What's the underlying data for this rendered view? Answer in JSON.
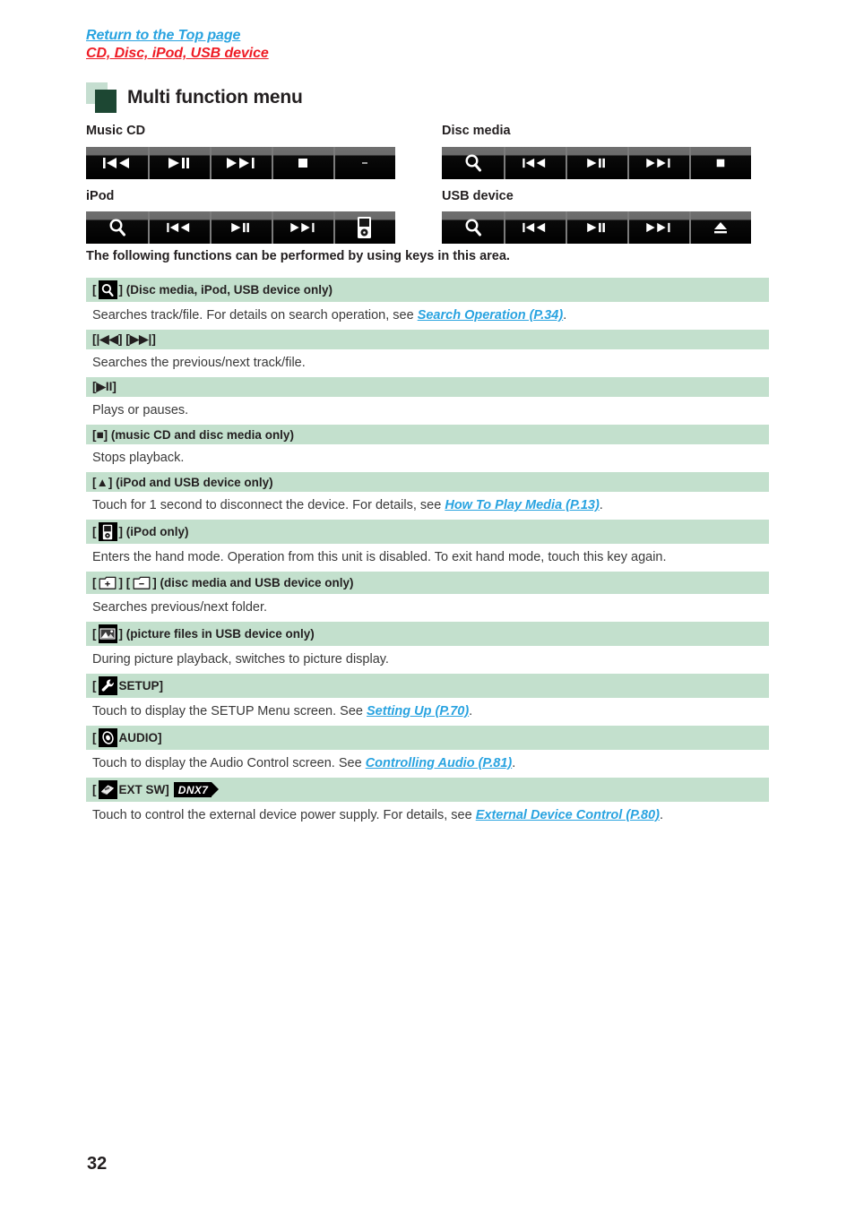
{
  "top_links": {
    "return_top": "Return to the Top page",
    "breadcrumb": "CD, Disc, iPod, USB device"
  },
  "heading": {
    "title": "Multi function menu",
    "mark_light_color": "#c5ded0",
    "mark_dark_color": "#1d4733"
  },
  "media_panels": [
    {
      "label": "Music CD",
      "keys": [
        "prev-track-icon",
        "play-pause-icon",
        "next-track-icon",
        "stop-icon",
        "blank-key"
      ]
    },
    {
      "label": "Disc media",
      "keys": [
        "search-icon",
        "prev-track-icon",
        "play-pause-icon",
        "next-track-icon",
        "stop-icon"
      ]
    },
    {
      "label": "iPod",
      "keys": [
        "search-icon",
        "prev-track-icon",
        "play-pause-icon",
        "next-track-icon",
        "ipod-hand-mode-icon"
      ]
    },
    {
      "label": "USB device",
      "keys": [
        "search-icon",
        "prev-track-icon",
        "play-pause-icon",
        "next-track-icon",
        "eject-icon"
      ]
    }
  ],
  "intro": "The following functions can be performed by using keys in this area.",
  "rows": [
    {
      "head_prefix": "[",
      "head_icon": "search-icon",
      "head_suffix": "] (Disc media, iPod, USB device only)",
      "body_before": "Searches track/file. For details on search operation, see ",
      "body_link": "Search Operation (P.34)",
      "body_after": "."
    },
    {
      "head_text": "[|◀◀] [▶▶|]",
      "body_before": "Searches the previous/next track/file.",
      "body_link": "",
      "body_after": ""
    },
    {
      "head_text": "[▶II]",
      "body_before": "Plays or pauses.",
      "body_link": "",
      "body_after": ""
    },
    {
      "head_text": "[■] (music CD and disc media only)",
      "body_before": "Stops playback.",
      "body_link": "",
      "body_after": ""
    },
    {
      "head_text": "[▲] (iPod and USB device only)",
      "body_before": "Touch for 1 second to disconnect the device. For details, see ",
      "body_link": "How To Play Media (P.13)",
      "body_after": "."
    },
    {
      "head_prefix": "[",
      "head_icon": "ipod-hand-mode-icon",
      "head_suffix": "] (iPod only)",
      "body_before": "Enters the hand mode. Operation from this unit is disabled. To exit hand mode, touch this key again.",
      "body_link": "",
      "body_after": ""
    },
    {
      "head_prefix": "[",
      "head_icon": "folder-up-icon",
      "head_mid": "] [",
      "head_icon2": "folder-down-icon",
      "head_suffix": "] (disc media and USB device only)",
      "body_before": "Searches previous/next folder.",
      "body_link": "",
      "body_after": ""
    },
    {
      "head_prefix": "[",
      "head_icon": "picture-icon",
      "head_suffix": "] (picture files in USB device only)",
      "body_before": "During picture playback, switches to picture display.",
      "body_link": "",
      "body_after": ""
    },
    {
      "head_prefix": "[",
      "head_icon": "setup-wrench-icon",
      "head_suffix": "SETUP]",
      "body_before": "Touch to display the SETUP Menu screen. See ",
      "body_link": "Setting Up (P.70)",
      "body_after": "."
    },
    {
      "head_prefix": "[",
      "head_icon": "audio-speaker-icon",
      "head_suffix": "AUDIO]",
      "body_before": "Touch to display the Audio Control screen. See ",
      "body_link": "Controlling Audio (P.81)",
      "body_after": "."
    },
    {
      "head_prefix": "[",
      "head_icon": "ext-sw-icon",
      "head_suffix": "EXT SW]",
      "head_badge": "DNX7",
      "body_before": "Touch to control the external device power supply. For details, see ",
      "body_link": "External Device Control (P.80)",
      "body_after": "."
    }
  ],
  "page_number": "32",
  "colors": {
    "link_blue": "#29a3e0",
    "breadcrumb_red": "#ee1c25",
    "row_head_green": "#c3e0cd",
    "key_bar_black": "#000000"
  }
}
